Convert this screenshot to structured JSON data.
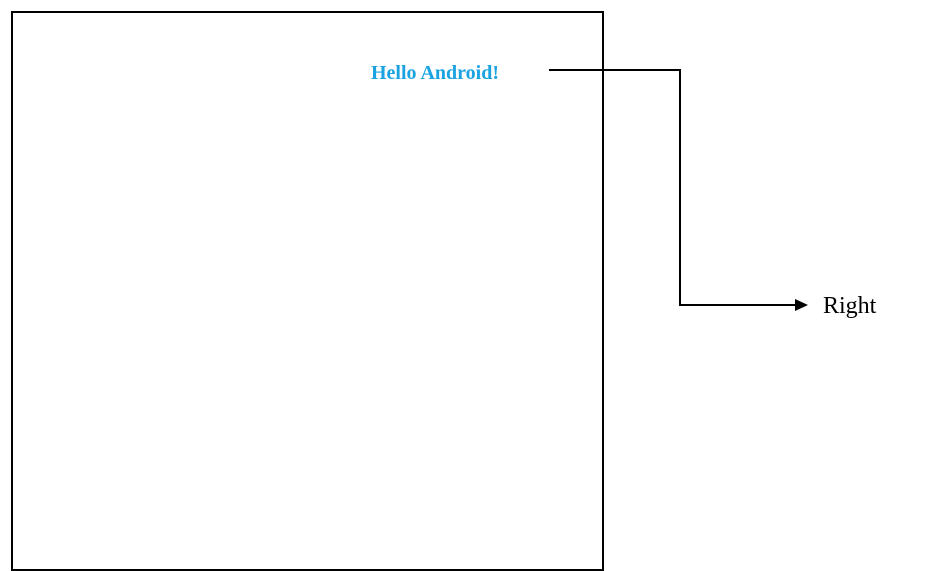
{
  "screen": {
    "hello_text": "Hello Android!",
    "text_color": "#1aa3e0"
  },
  "annotation": {
    "label": "Right"
  }
}
